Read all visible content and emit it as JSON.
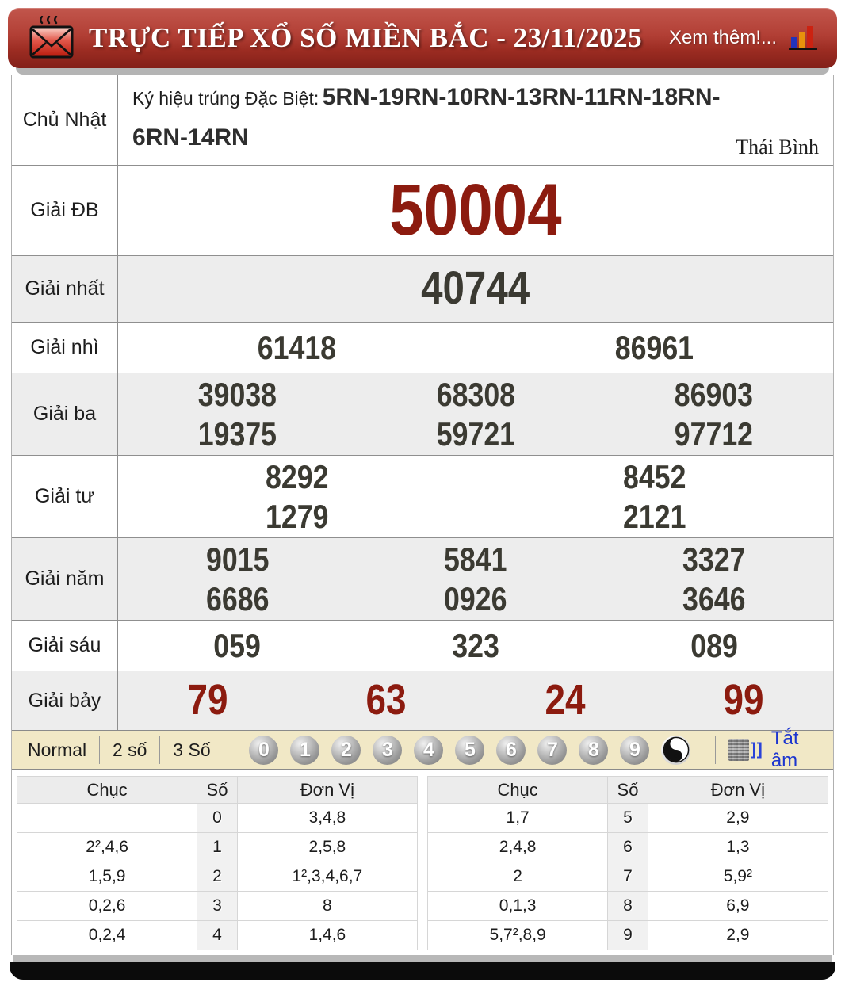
{
  "header": {
    "title": "TRỰC TIẾP XỔ SỐ MIỀN BẮC - 23/11/2025",
    "more_label": "Xem thêm!...",
    "mail_icon": "hot-mail-icon",
    "chart_icon": "bar-chart-icon"
  },
  "results": {
    "day_label": "Chủ Nhật",
    "symbol_prefix": "Ký hiệu trúng Đặc Biệt:",
    "symbol_value": "5RN-19RN-10RN-13RN-11RN-18RN-6RN-14RN",
    "province": "Thái Bình",
    "prizes": {
      "db": {
        "label": "Giải ĐB",
        "values": [
          "50004"
        ]
      },
      "nhat": {
        "label": "Giải nhất",
        "values": [
          "40744"
        ]
      },
      "nhi": {
        "label": "Giải nhì",
        "values": [
          "61418",
          "86961"
        ]
      },
      "ba": {
        "label": "Giải ba",
        "values": [
          "39038",
          "68308",
          "86903",
          "19375",
          "59721",
          "97712"
        ]
      },
      "tu": {
        "label": "Giải tư",
        "values": [
          "8292",
          "8452",
          "1279",
          "2121"
        ]
      },
      "nam": {
        "label": "Giải năm",
        "values": [
          "9015",
          "5841",
          "3327",
          "6686",
          "0926",
          "3646"
        ]
      },
      "sau": {
        "label": "Giải sáu",
        "values": [
          "059",
          "323",
          "089"
        ]
      },
      "bay": {
        "label": "Giải bảy",
        "values": [
          "79",
          "63",
          "24",
          "99"
        ]
      }
    }
  },
  "toolbar": {
    "modes": [
      "Normal",
      "2 số",
      "3 Số"
    ],
    "balls": [
      "0",
      "1",
      "2",
      "3",
      "4",
      "5",
      "6",
      "7",
      "8",
      "9"
    ],
    "yinyang_icon": "yin-yang-icon",
    "speaker_icon": "speaker-static-icon",
    "mute_label": "Tắt âm"
  },
  "stats": {
    "headers": [
      "Chục",
      "Số",
      "Đơn Vị"
    ],
    "left": [
      {
        "chuc": "",
        "so": "0",
        "donvi": "3,4,8"
      },
      {
        "chuc": "2²,4,6",
        "so": "1",
        "donvi": "2,5,8"
      },
      {
        "chuc": "1,5,9",
        "so": "2",
        "donvi": "1²,3,4,6,7"
      },
      {
        "chuc": "0,2,6",
        "so": "3",
        "donvi": "8"
      },
      {
        "chuc": "0,2,4",
        "so": "4",
        "donvi": "1,4,6"
      }
    ],
    "right": [
      {
        "chuc": "1,7",
        "so": "5",
        "donvi": "2,9"
      },
      {
        "chuc": "2,4,8",
        "so": "6",
        "donvi": "1,3"
      },
      {
        "chuc": "2",
        "so": "7",
        "donvi": "5,9²"
      },
      {
        "chuc": "0,1,3",
        "so": "8",
        "donvi": "6,9"
      },
      {
        "chuc": "5,7²,8,9",
        "so": "9",
        "donvi": "2,9"
      }
    ]
  },
  "colors": {
    "header_red": "#a93226",
    "prize_red": "#8c1b0f",
    "number_dark": "#3b3a32",
    "toolbar_cream": "#f1e8c6",
    "link_blue": "#1c35cf",
    "alt_row": "#ededed"
  }
}
